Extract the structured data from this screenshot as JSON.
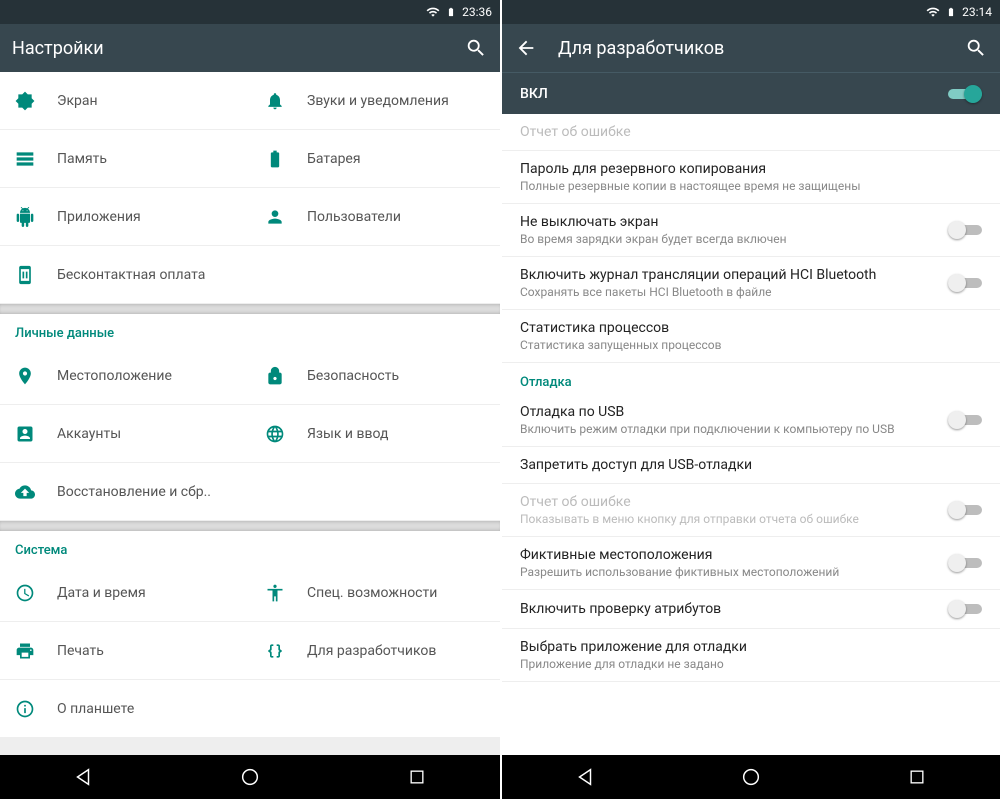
{
  "left": {
    "status_time": "23:36",
    "title": "Настройки",
    "items": [
      {
        "label": "Экран"
      },
      {
        "label": "Звуки и уведомления"
      },
      {
        "label": "Память"
      },
      {
        "label": "Батарея"
      },
      {
        "label": "Приложения"
      },
      {
        "label": "Пользователи"
      },
      {
        "label": "Бесконтактная оплата"
      }
    ],
    "sections": [
      {
        "header": "Личные данные",
        "items": [
          {
            "label": "Местоположение"
          },
          {
            "label": "Безопасность"
          },
          {
            "label": "Аккаунты"
          },
          {
            "label": "Язык и ввод"
          },
          {
            "label": "Восстановление и сбр.."
          }
        ]
      },
      {
        "header": "Система",
        "items": [
          {
            "label": "Дата и время"
          },
          {
            "label": "Спец. возможности"
          },
          {
            "label": "Печать"
          },
          {
            "label": "Для разработчиков"
          },
          {
            "label": "О планшете"
          }
        ]
      }
    ]
  },
  "right": {
    "status_time": "23:14",
    "title": "Для разработчиков",
    "master_label": "ВКЛ",
    "rows": [
      {
        "title": "Отчет об ошибке",
        "sub": "",
        "toggle": null,
        "disabled": true
      },
      {
        "title": "Пароль для резервного копирования",
        "sub": "Полные резервные копии в настоящее время не защищены",
        "toggle": null
      },
      {
        "title": "Не выключать экран",
        "sub": "Во время зарядки экран будет всегда включен",
        "toggle": false
      },
      {
        "title": "Включить журнал трансляции операций HCI Bluetooth",
        "sub": "Сохранять все пакеты HCI Bluetooth в файле",
        "toggle": false
      },
      {
        "title": "Статистика процессов",
        "sub": "Статистика запущенных процессов",
        "toggle": null
      },
      {
        "cat": "Отладка"
      },
      {
        "title": "Отладка по USB",
        "sub": "Включить режим отладки при подключении к компьютеру по USB",
        "toggle": false
      },
      {
        "title": "Запретить доступ для USB-отладки",
        "sub": "",
        "toggle": null
      },
      {
        "title": "Отчет об ошибке",
        "sub": "Показывать в меню кнопку для отправки отчета об ошибке",
        "toggle": false,
        "disabled": true
      },
      {
        "title": "Фиктивные местоположения",
        "sub": "Разрешить использование фиктивных местоположений",
        "toggle": false
      },
      {
        "title": "Включить проверку атрибутов",
        "sub": "",
        "toggle": false
      },
      {
        "title": "Выбрать приложение для отладки",
        "sub": "Приложение для отладки не задано",
        "toggle": null
      }
    ]
  }
}
